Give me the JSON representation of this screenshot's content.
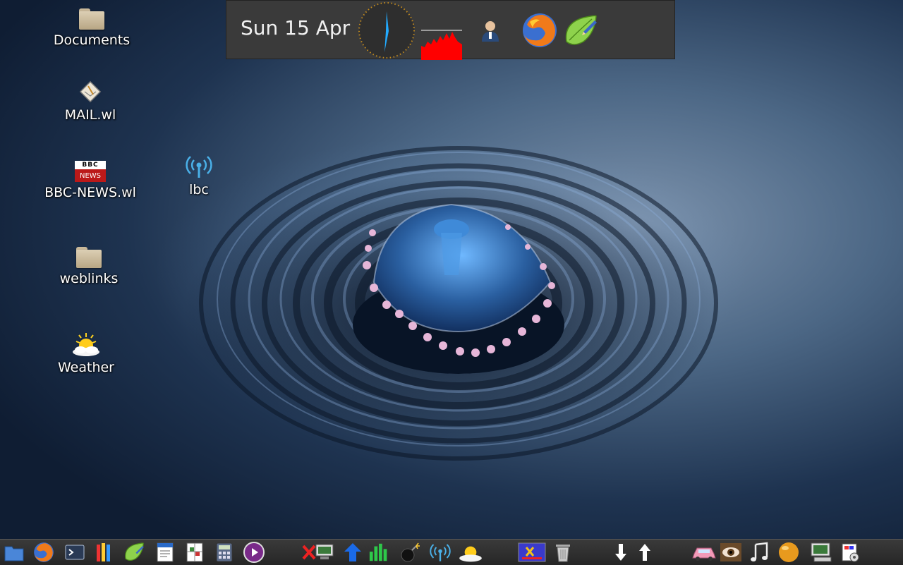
{
  "desktop": {
    "icons": [
      {
        "label": "Documents",
        "icon": "folder-icon"
      },
      {
        "label": "MAIL.wl",
        "icon": "mail-icon"
      },
      {
        "label": "BBC-NEWS.wl",
        "icon": "bbc-news-icon"
      },
      {
        "label": "lbc",
        "icon": "radio-wireless-icon"
      },
      {
        "label": "weblinks",
        "icon": "folder-icon"
      },
      {
        "label": "Weather",
        "icon": "weather-sun-icon"
      }
    ],
    "bbc_logo": {
      "top": "BBC",
      "bottom": "NEWS"
    }
  },
  "top_panel": {
    "date": "Sun 15 Apr",
    "items": [
      "clock-icon",
      "cpu-graph-icon",
      "user-icon",
      "firefox-icon",
      "leafpad-icon"
    ]
  },
  "taskbar": {
    "icons": [
      "file-manager-icon",
      "firefox-icon",
      "terminal-icon",
      "pencils-icon",
      "leafpad-icon",
      "document-writer-icon",
      "spreadsheet-icon",
      "calculator-icon",
      "media-player-icon",
      "network-disconnected-icon",
      "upload-arrow-icon",
      "equalizer-icon",
      "bomb-icon",
      "wireless-icon",
      "weather-icon",
      "image-viewer-icon",
      "trash-icon",
      "download-arrow-icon",
      "up-arrow-icon",
      "car-icon",
      "eye-icon",
      "music-note-icon",
      "orange-ball-icon",
      "computer-icon",
      "display-settings-icon"
    ]
  },
  "colors": {
    "panel_bg": "#3a3a3a",
    "taskbar_bg": "#2c2c2c",
    "cpu_graph": "#ff0000",
    "clock_needle": "#22aaff"
  }
}
